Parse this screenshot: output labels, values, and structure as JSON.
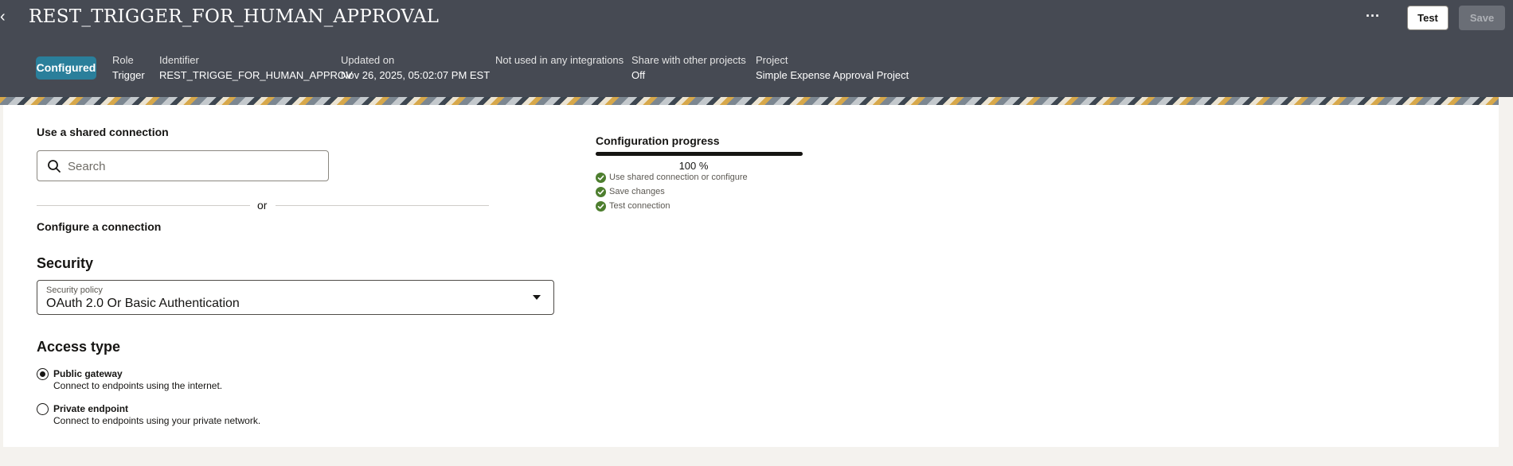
{
  "header": {
    "title": "REST_TRIGGER_FOR_HUMAN_APPROVAL",
    "more_label": "···",
    "test_label": "Test",
    "save_label": "Save",
    "status": "Configured",
    "meta": {
      "role_label": "Role",
      "role_value": "Trigger",
      "identifier_label": "Identifier",
      "identifier_value": "REST_TRIGGE_FOR_HUMAN_APPROV",
      "updated_label": "Updated on",
      "updated_value": "Nov 26, 2025, 05:02:07 PM EST",
      "usage_text": "Not used in any integrations",
      "share_label": "Share with other projects",
      "share_value": "Off",
      "project_label": "Project",
      "project_value": "Simple Expense Approval Project"
    }
  },
  "shared_connection": {
    "label": "Use a shared connection",
    "search_placeholder": "Search"
  },
  "divider": {
    "or_text": "or"
  },
  "configure": {
    "label": "Configure a connection"
  },
  "security": {
    "heading": "Security",
    "policy_label": "Security policy",
    "policy_value": "OAuth 2.0 Or Basic Authentication"
  },
  "access_type": {
    "heading": "Access type",
    "options": [
      {
        "title": "Public gateway",
        "description": "Connect to endpoints using the internet.",
        "selected": true
      },
      {
        "title": "Private endpoint",
        "description": "Connect to endpoints using your private network.",
        "selected": false
      }
    ]
  },
  "progress": {
    "title": "Configuration progress",
    "percent": 100,
    "percent_text": "100 %",
    "steps": [
      {
        "label": "Use shared connection or configure",
        "done": true
      },
      {
        "label": "Save changes",
        "done": true
      },
      {
        "label": "Test connection",
        "done": true
      }
    ]
  },
  "colors": {
    "header_bg": "#464a53",
    "badge_bg": "#2a7f9b",
    "check_green": "#4d7e2e",
    "progress_fill": "#161513"
  }
}
